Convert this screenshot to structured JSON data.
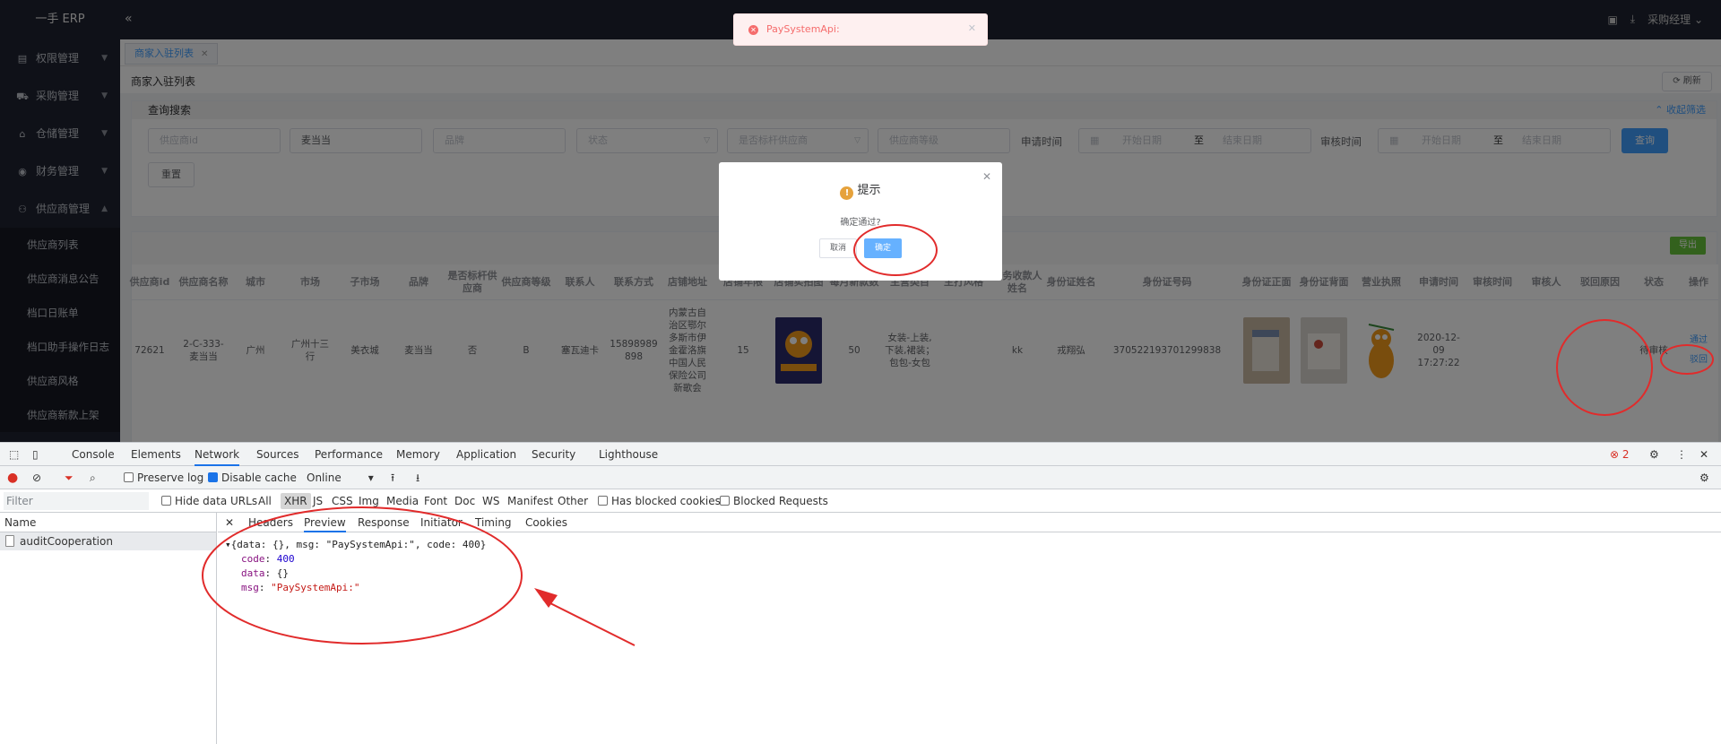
{
  "app": {
    "logo": "一手 ERP",
    "collapse_icon": "«",
    "user": "采购经理"
  },
  "sidebar": {
    "menus": [
      {
        "label": "权限管理",
        "icon": "permission-icon"
      },
      {
        "label": "采购管理",
        "icon": "cart-icon"
      },
      {
        "label": "仓储管理",
        "icon": "warehouse-icon"
      },
      {
        "label": "财务管理",
        "icon": "finance-icon"
      },
      {
        "label": "供应商管理",
        "icon": "supplier-icon",
        "expanded": true
      }
    ],
    "submenus": [
      "供应商列表",
      "供应商消息公告",
      "档口日账单",
      "档口助手操作日志",
      "供应商风格",
      "供应商新款上架"
    ]
  },
  "tabs": {
    "active": "商家入驻列表"
  },
  "page": {
    "title": "商家入驻列表",
    "refresh": "刷新"
  },
  "search": {
    "header": "查询搜索",
    "collapse": "收起筛选",
    "supplier_id_ph": "供应商id",
    "brand_value": "麦当当",
    "brand_ph": "品牌",
    "status_ph": "状态",
    "benchmark_ph": "是否标杆供应商",
    "level_ph": "供应商等级",
    "apply_time_label": "申请时间",
    "audit_time_label": "审核时间",
    "start_ph": "开始日期",
    "to": "至",
    "end_ph": "结束日期",
    "query_btn": "查询",
    "reset_btn": "重置"
  },
  "table": {
    "export": "导出",
    "headers": [
      "供应商id",
      "供应商名称",
      "城市",
      "市场",
      "子市场",
      "品牌",
      "是否标杆供应商",
      "供应商等级",
      "联系人",
      "联系方式",
      "店铺地址",
      "店铺年限",
      "店铺实拍图",
      "每月新款数",
      "主营类目",
      "主打风格",
      "财务收款人姓名",
      "身份证姓名",
      "身份证号码",
      "身份证正面",
      "身份证背面",
      "营业执照",
      "申请时间",
      "审核时间",
      "审核人",
      "驳回原因",
      "状态",
      "操作"
    ],
    "row": {
      "supplier_id": "72621",
      "name": "2-C-333-麦当当",
      "city": "广州",
      "market": "广州十三行",
      "sub_market": "美衣城",
      "brand": "麦当当",
      "benchmark": "否",
      "level": "B",
      "contact": "塞瓦迪卡",
      "phone": "15898989898",
      "address": "内蒙古自治区鄂尔多斯市伊金霍洛旗中国人民保险公司新歌会",
      "years": "15",
      "monthly_new": "50",
      "category": "女装-上装,下装,裙装；包包-女包",
      "style": "",
      "payee": "kk",
      "id_name": "戎翔弘",
      "id_number": "370522193701299838",
      "apply_time": "2020-12-09 17:27:22",
      "audit_time": "",
      "auditor": "",
      "reject_reason": "",
      "status": "待审核",
      "op_pass": "通过",
      "op_reject": "驳回"
    }
  },
  "toast": {
    "message": "PaySystemApi:"
  },
  "dialog": {
    "title": "提示",
    "message": "确定通过?",
    "cancel": "取消",
    "confirm": "确定"
  },
  "devtools": {
    "tabs": [
      "Console",
      "Elements",
      "Network",
      "Sources",
      "Performance",
      "Memory",
      "Application",
      "Security",
      "Lighthouse"
    ],
    "active_tab": "Network",
    "error_count": "2",
    "toolbar": {
      "preserve_log": "Preserve log",
      "disable_cache": "Disable cache",
      "throttle": "Online"
    },
    "filter": {
      "placeholder": "Filter",
      "hide_data_urls": "Hide data URLs",
      "types": [
        "All",
        "XHR",
        "JS",
        "CSS",
        "Img",
        "Media",
        "Font",
        "Doc",
        "WS",
        "Manifest",
        "Other"
      ],
      "active_type": "XHR",
      "blocked_cookies": "Has blocked cookies",
      "blocked_requests": "Blocked Requests"
    },
    "name_header": "Name",
    "request": "auditCooperation",
    "detail_tabs": [
      "Headers",
      "Preview",
      "Response",
      "Initiator",
      "Timing",
      "Cookies"
    ],
    "active_detail": "Preview",
    "preview": {
      "summary": "{data: {}, msg: \"PaySystemApi:\", code: 400}",
      "code_key": "code",
      "code_val": "400",
      "data_key": "data",
      "data_val": "{}",
      "msg_key": "msg",
      "msg_val": "\"PaySystemApi:\""
    }
  },
  "colors": {
    "sidebar_bg": "#1f2330",
    "primary": "#409eff",
    "success": "#67c23a",
    "warning": "#e6a23c",
    "danger": "#f56c6c",
    "annotation_red": "#e12b2b"
  }
}
